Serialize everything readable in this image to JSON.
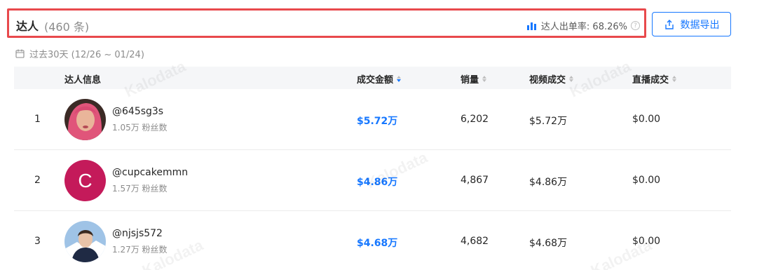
{
  "header": {
    "title": "达人",
    "count": "(460 条)",
    "rate_text": "达人出单率: 68.26%",
    "help_glyph": "?"
  },
  "export_button": {
    "label": "数据导出"
  },
  "date_range": {
    "text": "过去30天 (12/26 ~ 01/24)"
  },
  "table": {
    "columns": [
      "达人信息",
      "成交金额",
      "销量",
      "视频成交",
      "直播成交"
    ],
    "rows": [
      {
        "rank": "1",
        "handle": "@645sg3s",
        "fans": "1.05万 粉丝数",
        "amount": "$5.72万",
        "sales": "6,202",
        "video": "$5.72万",
        "live": "$0.00",
        "avatar": "photo"
      },
      {
        "rank": "2",
        "handle": "@cupcakemmn",
        "fans": "1.57万 粉丝数",
        "amount": "$4.86万",
        "sales": "4,867",
        "video": "$4.86万",
        "live": "$0.00",
        "avatar": "C"
      },
      {
        "rank": "3",
        "handle": "@njsjs572",
        "fans": "1.27万 粉丝数",
        "amount": "$4.68万",
        "sales": "4,682",
        "video": "$4.68万",
        "live": "$0.00",
        "avatar": "photo"
      }
    ]
  },
  "watermark": "Kalodata",
  "colors": {
    "accent": "#1677ff",
    "highlight_border": "#e8494c"
  }
}
